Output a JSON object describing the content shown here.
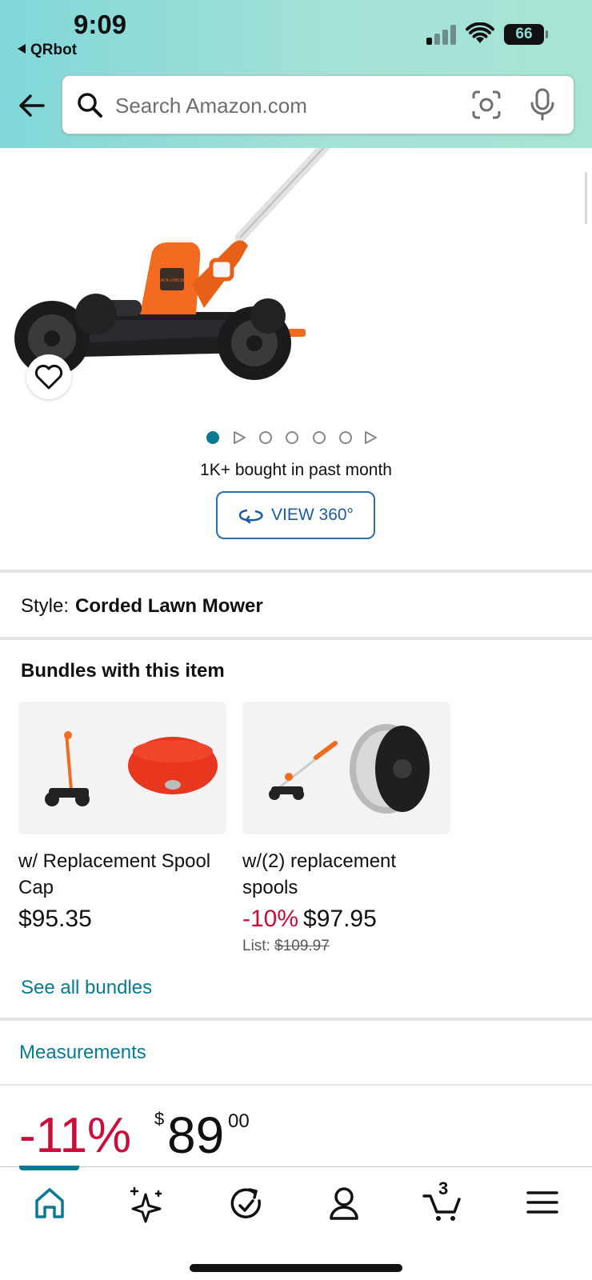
{
  "status_bar": {
    "time": "9:09",
    "back_app": "QRbot",
    "battery": "66"
  },
  "search": {
    "placeholder": "Search Amazon.com"
  },
  "product": {
    "brand_badge": "BLACK+DECKER",
    "image_count": 7,
    "active_image": 1,
    "bought_text": "1K+ bought in past month",
    "view360_label": "VIEW 360°"
  },
  "style": {
    "label": "Style:",
    "value": "Corded Lawn Mower"
  },
  "bundles": {
    "title": "Bundles with this item",
    "items": [
      {
        "name": "w/ Replacement Spool Cap",
        "price": "$95.35"
      },
      {
        "name": "w/(2) replacement spools",
        "discount": "-10%",
        "price": "$97.95",
        "list_label": "List:",
        "list_price": "$109.97"
      }
    ],
    "see_all": "See all bundles"
  },
  "measurements_link": "Measurements",
  "price": {
    "discount": "-11%",
    "currency": "$",
    "whole": "89",
    "fraction": "00"
  },
  "bottom_nav": {
    "cart_count": "3",
    "items": [
      "home-icon",
      "rufus-sparkle-icon",
      "orders-refresh-icon",
      "account-icon",
      "cart-icon",
      "menu-icon"
    ],
    "active": "home-icon"
  },
  "colors": {
    "accent_teal": "#087b92",
    "deal_red": "#cc0c39",
    "link_blue": "#1c5aa3",
    "header_gradient_start": "#80d7d9",
    "header_gradient_end": "#a6e4d5",
    "product_orange": "#f26b21"
  }
}
